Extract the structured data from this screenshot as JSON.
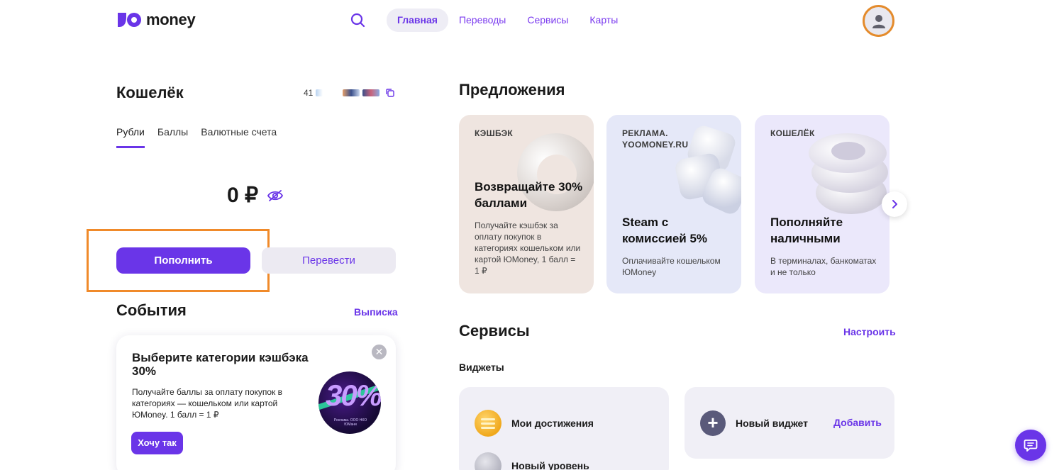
{
  "header": {
    "logo_text": "money",
    "nav": [
      {
        "label": "Главная",
        "active": true
      },
      {
        "label": "Переводы",
        "active": false
      },
      {
        "label": "Сервисы",
        "active": false
      },
      {
        "label": "Карты",
        "active": false
      }
    ],
    "icons": {
      "search": "search-icon",
      "avatar": "user-icon"
    },
    "accent_color": "#6a35e8"
  },
  "wallet": {
    "title": "Кошелёк",
    "number_prefix": "41",
    "tabs": [
      {
        "label": "Рубли",
        "active": true
      },
      {
        "label": "Баллы",
        "active": false
      },
      {
        "label": "Валютные счета",
        "active": false
      }
    ],
    "balance": "0 ₽",
    "topup_label": "Пополнить",
    "transfer_label": "Перевести"
  },
  "events": {
    "title": "События",
    "statement_label": "Выписка",
    "promo": {
      "title": "Выберите категории кэшбэка 30%",
      "text": "Получайте баллы за оплату покупок в категориях — кошельком или картой ЮMoney. 1 балл = 1 ₽",
      "button_label": "Хочу так",
      "close_symbol": "✕",
      "badge_number": "30%",
      "badge_fineprint": "Реклама. ООО НКО ЮМани"
    }
  },
  "offers": {
    "title": "Предложения",
    "items": [
      {
        "tag": "КЭШБЭК",
        "heading": "Возвращайте 30% баллами",
        "description": "Получайте кэшбэк за оплату покупок в категориях кошельком или картой ЮMoney, 1 балл = 1 ₽"
      },
      {
        "tag": "РЕКЛАМА. YOOMONEY.RU",
        "heading": "Steam с комиссией 5%",
        "description": "Оплачивайте кошельком ЮMoney"
      },
      {
        "tag": "КОШЕЛЁК",
        "heading": "Пополняйте наличными",
        "description": "В терминалах, банкоматах и не только"
      }
    ]
  },
  "services": {
    "title": "Сервисы",
    "configure_label": "Настроить",
    "widgets_label": "Виджеты",
    "widget_items": [
      {
        "label": "Мои достижения"
      },
      {
        "label": "Новый уровень"
      }
    ],
    "new_widget_label": "Новый виджет",
    "add_label": "Добавить"
  }
}
